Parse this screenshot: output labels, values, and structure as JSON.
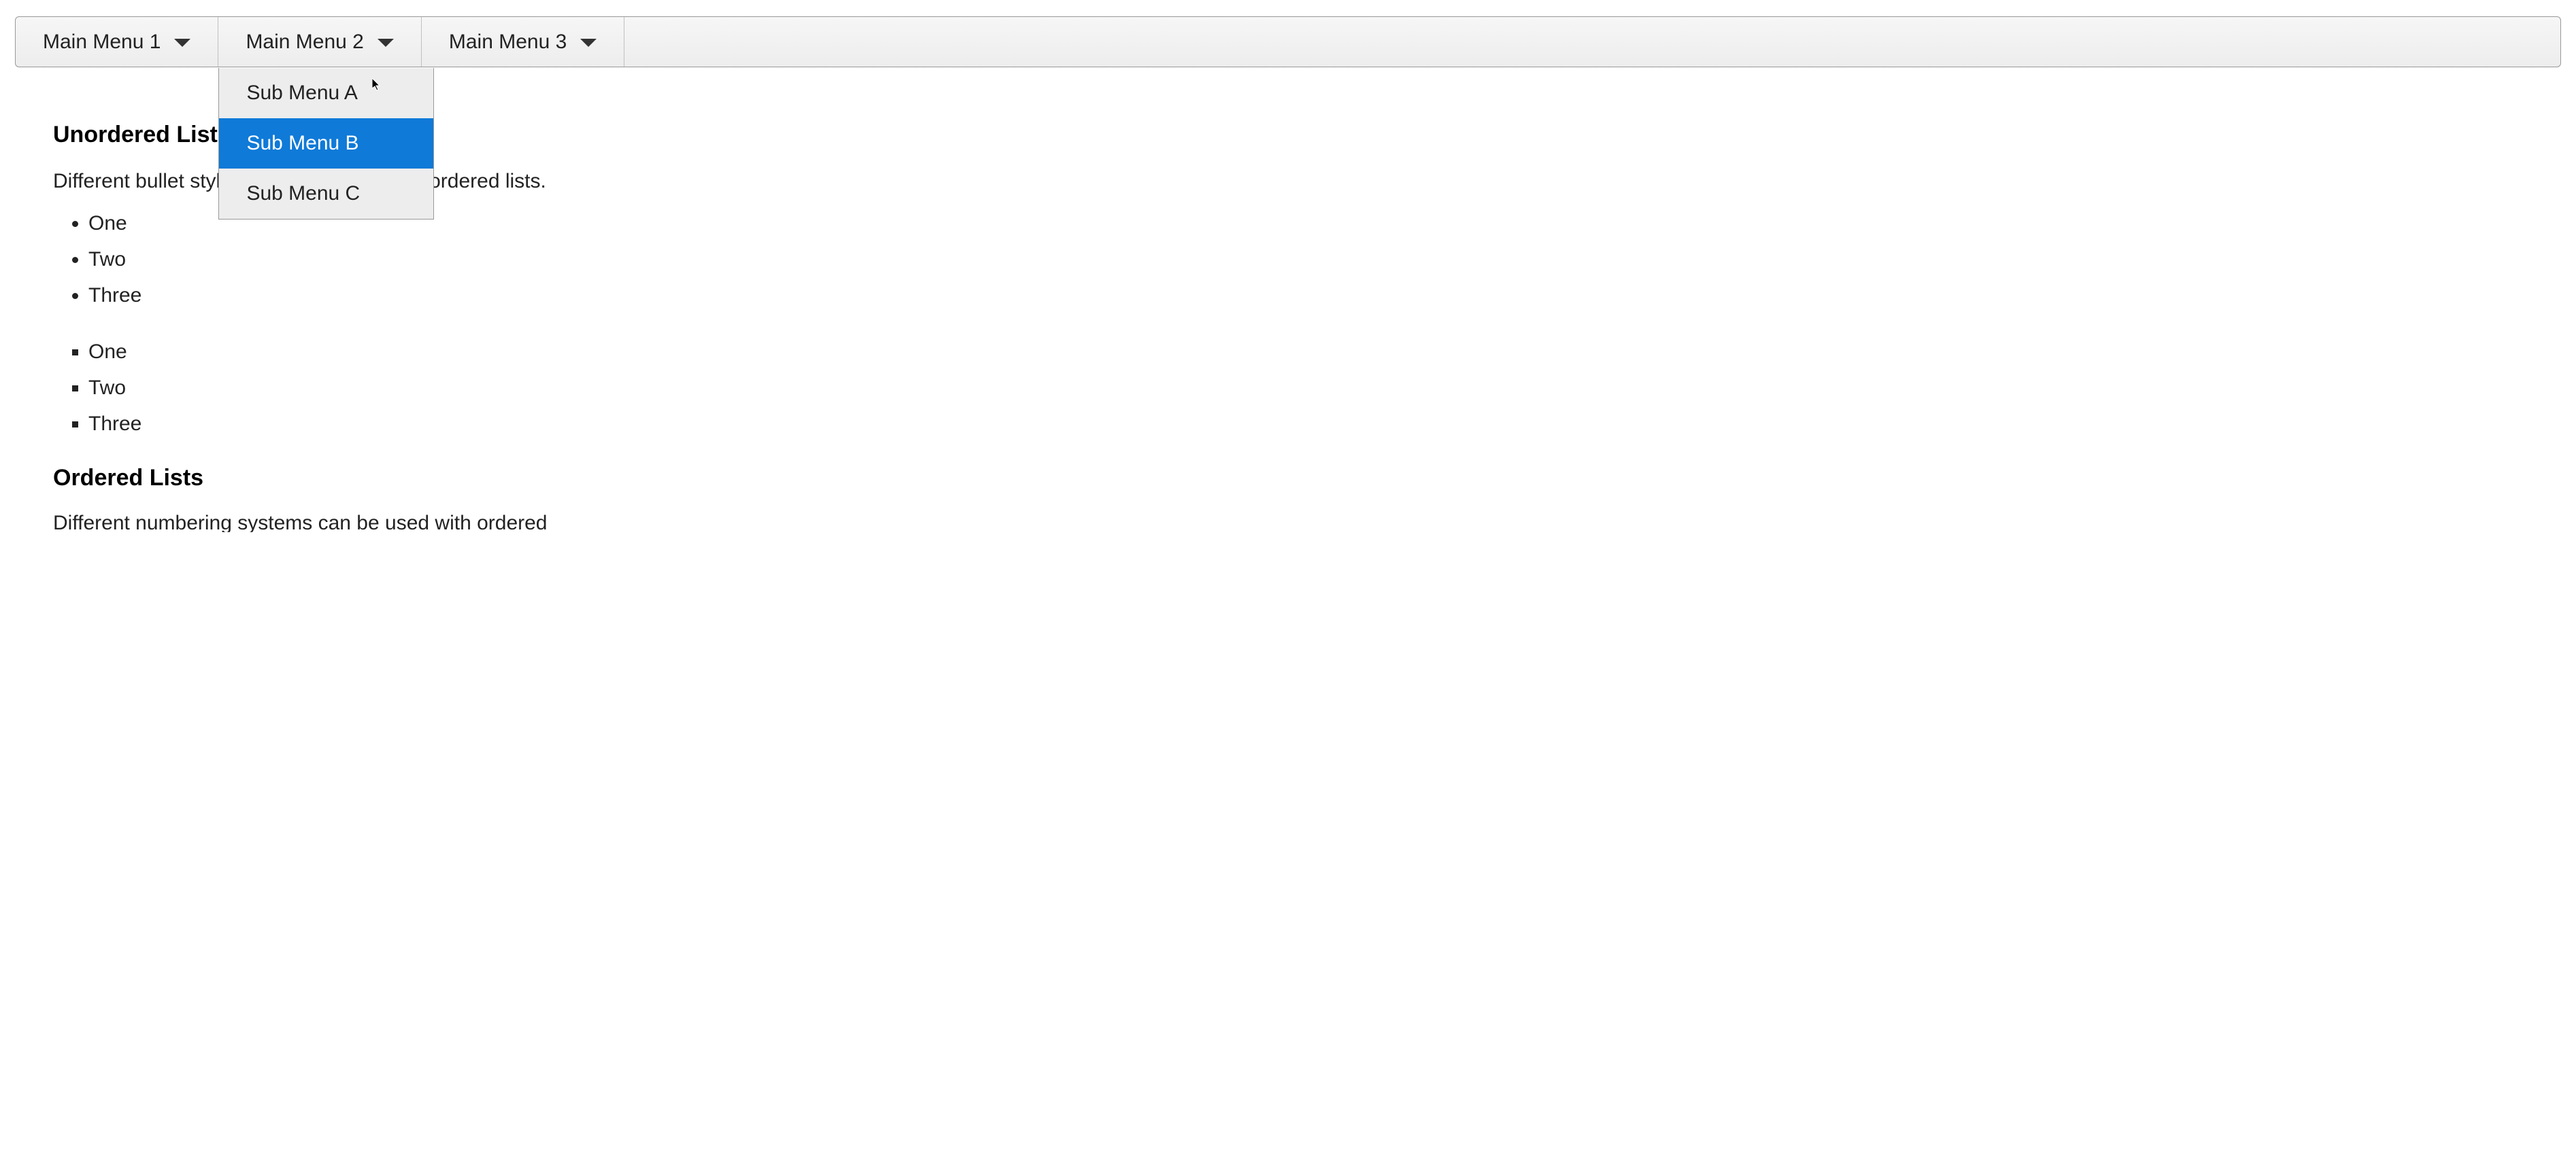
{
  "menubar": {
    "items": [
      {
        "label": "Main Menu 1"
      },
      {
        "label": "Main Menu 2"
      },
      {
        "label": "Main Menu 3"
      }
    ]
  },
  "submenu": {
    "items": [
      {
        "label": "Sub Menu A",
        "hovered": false
      },
      {
        "label": "Sub Menu B",
        "hovered": true
      },
      {
        "label": "Sub Menu C",
        "hovered": false
      }
    ]
  },
  "content": {
    "section1": {
      "heading": "Unordered Lists",
      "desc": "Different bullet styles can be used with unordered lists.",
      "list_disc": [
        "One",
        "Two",
        "Three"
      ],
      "list_square": [
        "One",
        "Two",
        "Three"
      ]
    },
    "section2": {
      "heading": "Ordered Lists",
      "desc": "Different numbering systems can be used with ordered"
    }
  }
}
